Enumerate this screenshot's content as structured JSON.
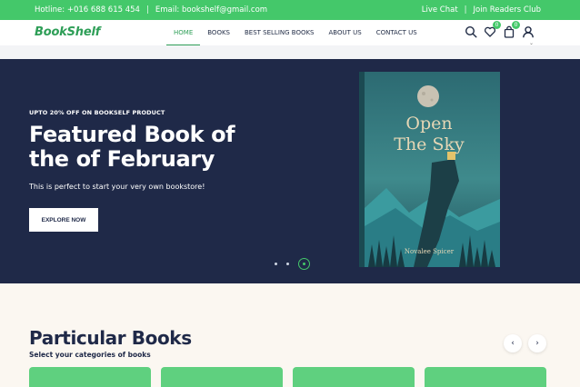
{
  "topbar": {
    "hotline": "Hotline: +016 688 615 454",
    "email": "Email: bookshelf@gmail.com",
    "live_chat": "Live Chat",
    "join_club": "Join Readers Club",
    "separator": "|"
  },
  "header": {
    "logo": "BookShelf",
    "nav": [
      "HOME",
      "BOOKS",
      "BEST SELLING BOOKS",
      "ABOUT US",
      "CONTACT US"
    ],
    "wishlist_count": "0",
    "cart_count": "0",
    "icons": [
      "search-icon",
      "heart-icon",
      "bag-icon",
      "user-icon"
    ]
  },
  "hero": {
    "promo": "UPTO 20% OFF ON BOOKSELF PRODUCT",
    "headline": "Featured Book of the of February",
    "subtitle": "This is perfect to start your very own bookstore!",
    "cta": "EXPLORE NOW",
    "book": {
      "title_line1": "Open",
      "title_line2": "The Sky",
      "author": "Novalee Spicer"
    }
  },
  "section": {
    "title": "Particular Books",
    "subtitle": "Select your categories of books"
  },
  "colors": {
    "accent": "#44c86a",
    "brand_green": "#2e9e57",
    "hero_bg": "#1f2948",
    "section_bg": "#fbf7f1",
    "card": "#5fd07f"
  }
}
